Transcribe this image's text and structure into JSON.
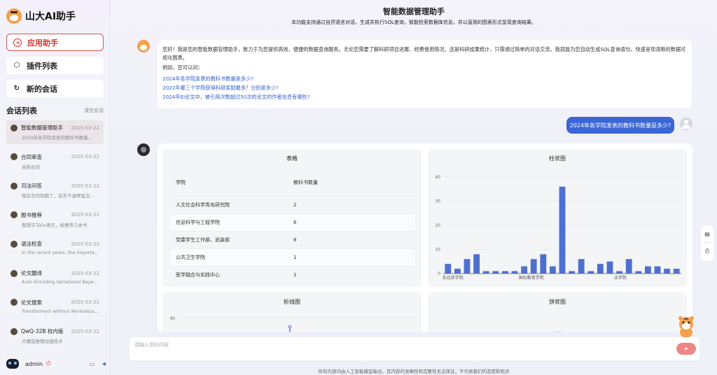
{
  "app": {
    "title": "山大AI助手"
  },
  "nav": [
    {
      "label": "应用助手",
      "icon": "app-icon",
      "active": true
    },
    {
      "label": "插件列表",
      "icon": "plugin-icon",
      "active": false
    },
    {
      "label": "新的会话",
      "icon": "new-chat-icon",
      "active": false
    }
  ],
  "sessions": {
    "title": "会话列表",
    "clear_label": "清空会话",
    "items": [
      {
        "name": "智能数据管理助手",
        "date": "2025-03-22",
        "preview": "2024年各学院发表的教科书数量...",
        "active": true
      },
      {
        "name": "合同审查",
        "date": "2025-03-22",
        "preview": "采购合同",
        "active": false
      },
      {
        "name": "司法问答",
        "date": "2025-03-22",
        "preview": "租房合同到期了，房东不退押金怎...",
        "active": false
      },
      {
        "name": "图书推荐",
        "date": "2025-03-22",
        "preview": "我想学习Go语言，给推荐几本书",
        "active": false
      },
      {
        "name": "语法检查",
        "date": "2025-03-22",
        "preview": "In the recent years, the importa...",
        "active": false
      },
      {
        "name": "论文翻译",
        "date": "2025-03-22",
        "preview": "Auto-Encoding Variational Baye...",
        "active": false
      },
      {
        "name": "论文搜索",
        "date": "2025-03-22",
        "preview": "Transformers without Normaliza...",
        "active": false
      },
      {
        "name": "QwQ-32B 校内版",
        "date": "2025-03-22",
        "preview": "大模型推理加速技术",
        "active": false
      }
    ]
  },
  "user": {
    "name": "admin"
  },
  "header": {
    "title": "智能数据管理助手",
    "subtitle": "本功能支持通过自然语言对话，生成并执行SQL查询，智能检索数据库信息，并以直观的图表形式呈现查询结果。"
  },
  "welcome": {
    "intro": "您好！我是您的智能数据管理助手，致力于为您提供高效、便捷的数据查询服务。无论您需要了解科研项目进展、经费使用情况，还是科研成果统计，只需通过简单的对话交流，我就能为您自动生成SQL查询语句，快速呈现清晰的数据可视化图表。",
    "example_label": "例如，您可以问：",
    "examples": [
      "2024年各学院发表的教科书数量是多少?",
      "2022年哪三个学院获得科研奖励最多？分别是多少?",
      "2024年EI论文中，被引用次数超过50次的论文的作者信息有哪些?"
    ]
  },
  "user_message": "2024年各学院发表的教科书数量是多少?",
  "result": {
    "table": {
      "title": "表格",
      "columns": [
        "学院",
        "教科书数量"
      ],
      "rows": [
        [
          "人文社会科学青岛研究院",
          "2"
        ],
        [
          "信息科学与工程学院",
          "6"
        ],
        [
          "党委学生工作部、武装部",
          "8"
        ],
        [
          "公共卫生学院",
          "1"
        ],
        [
          "医学融合与实践中心",
          "1"
        ]
      ]
    },
    "bar_title": "柱状图",
    "line_title": "折线图",
    "pie_title": "饼状图"
  },
  "chart_data": [
    {
      "type": "bar",
      "title": "柱状图",
      "ylim": [
        0,
        40
      ],
      "yticks": [
        0,
        10,
        20,
        30,
        40
      ],
      "xtick_labels": [
        "东北亚学院",
        "国际教育学院",
        "法学院"
      ],
      "values": [
        4,
        2,
        6,
        8,
        1,
        1,
        1,
        1,
        3,
        6,
        8,
        3,
        36,
        1,
        6,
        1,
        4,
        5,
        1,
        6,
        1,
        3,
        3,
        2,
        2
      ],
      "color": "#4f6fd0"
    },
    {
      "type": "line",
      "title": "折线图",
      "yticks": [
        40
      ],
      "color": "#4f6fd0"
    },
    {
      "type": "pie",
      "title": "饼状图",
      "colors": [
        "#4f6fd0",
        "#91cc75",
        "#fac858",
        "#ee6666",
        "#73c0de",
        "#3ba272",
        "#fc8452",
        "#9a60b4",
        "#ea7ccc"
      ]
    }
  ],
  "input": {
    "placeholder": "请输入您的内容"
  },
  "footer": {
    "note": "所有内容均由人工智能模型输出，其内容的准确性和完整性无法保证，不代表我们的态度和观点"
  }
}
